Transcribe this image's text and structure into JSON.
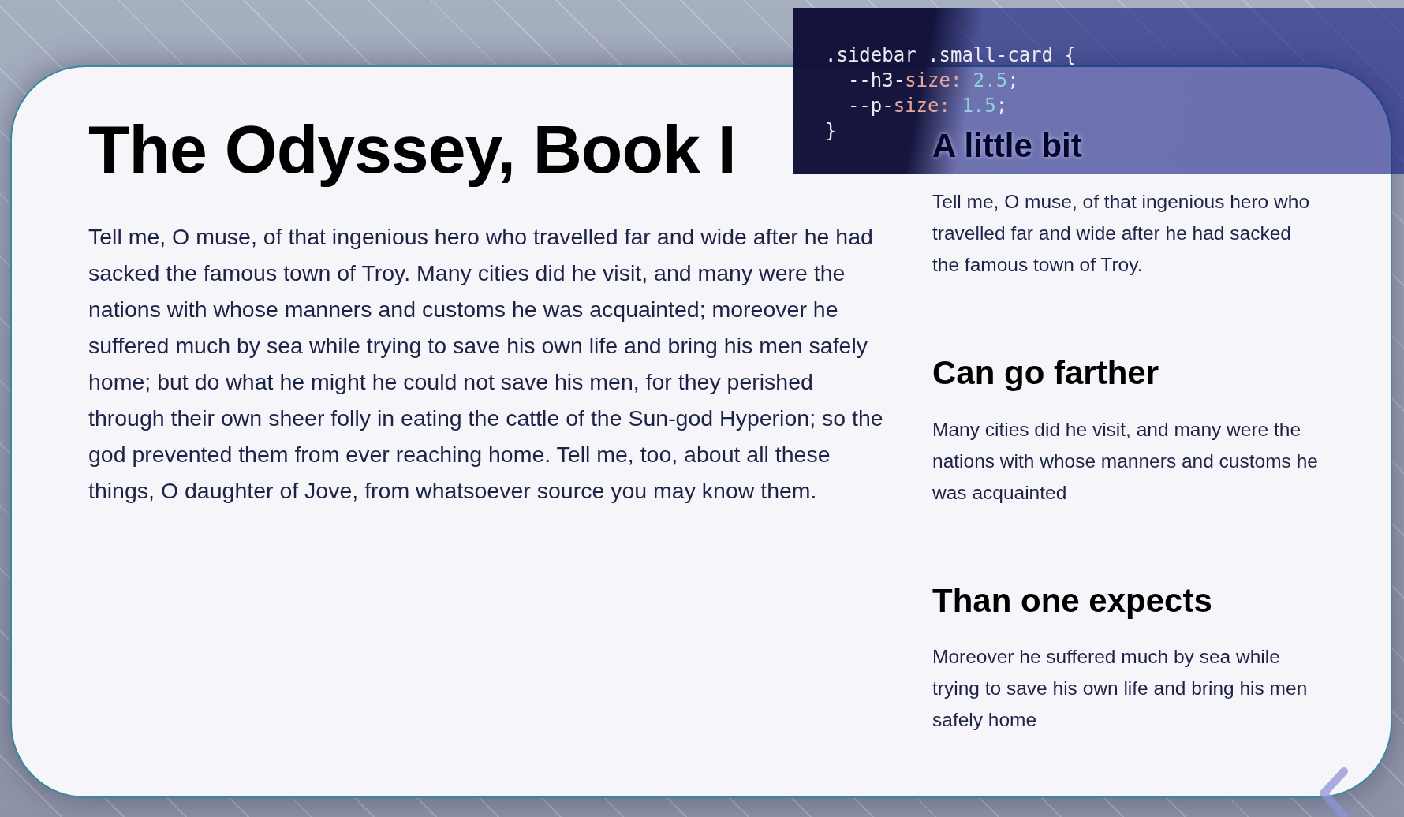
{
  "article": {
    "title": "The Odyssey, Book I",
    "body": "Tell me, O muse, of that ingenious hero who travelled far and wide after he had sacked the famous town of Troy. Many cities did he visit, and many were the nations with whose manners and customs he was acquainted; moreover he suffered much by sea while trying to save his own life and bring his men safely home; but do what he might he could not save his men, for they perished through their own sheer folly in eating the cattle of the Sun-god Hyperion; so the god prevented them from ever reaching home. Tell me, too, about all these things, O daughter of Jove, from whatsoever source you may know them."
  },
  "sidebar": {
    "cards": [
      {
        "heading": "A little bit",
        "text": "Tell me, O muse, of that ingenious hero who travelled far and wide after he had sacked the famous town of Troy."
      },
      {
        "heading": "Can go farther",
        "text": "Many cities did he visit, and many were the nations with whose manners and customs he was acquainted"
      },
      {
        "heading": "Than one expects",
        "text": "Moreover he suffered much by sea while trying to save his own life and bring his men safely home"
      }
    ]
  },
  "code_overlay": {
    "lines": [
      [
        {
          "text": ".sidebar .small-card {",
          "kind": "plain"
        }
      ],
      [
        {
          "text": "  --h3-",
          "kind": "plain"
        },
        {
          "text": "size:",
          "kind": "property"
        },
        {
          "text": " 2.5",
          "kind": "number"
        },
        {
          "text": ";",
          "kind": "plain"
        }
      ],
      [
        {
          "text": "  --p-",
          "kind": "plain"
        },
        {
          "text": "size:",
          "kind": "property"
        },
        {
          "text": " 1.5",
          "kind": "number"
        },
        {
          "text": ";",
          "kind": "plain"
        }
      ],
      [
        {
          "text": "}",
          "kind": "plain"
        }
      ]
    ]
  }
}
